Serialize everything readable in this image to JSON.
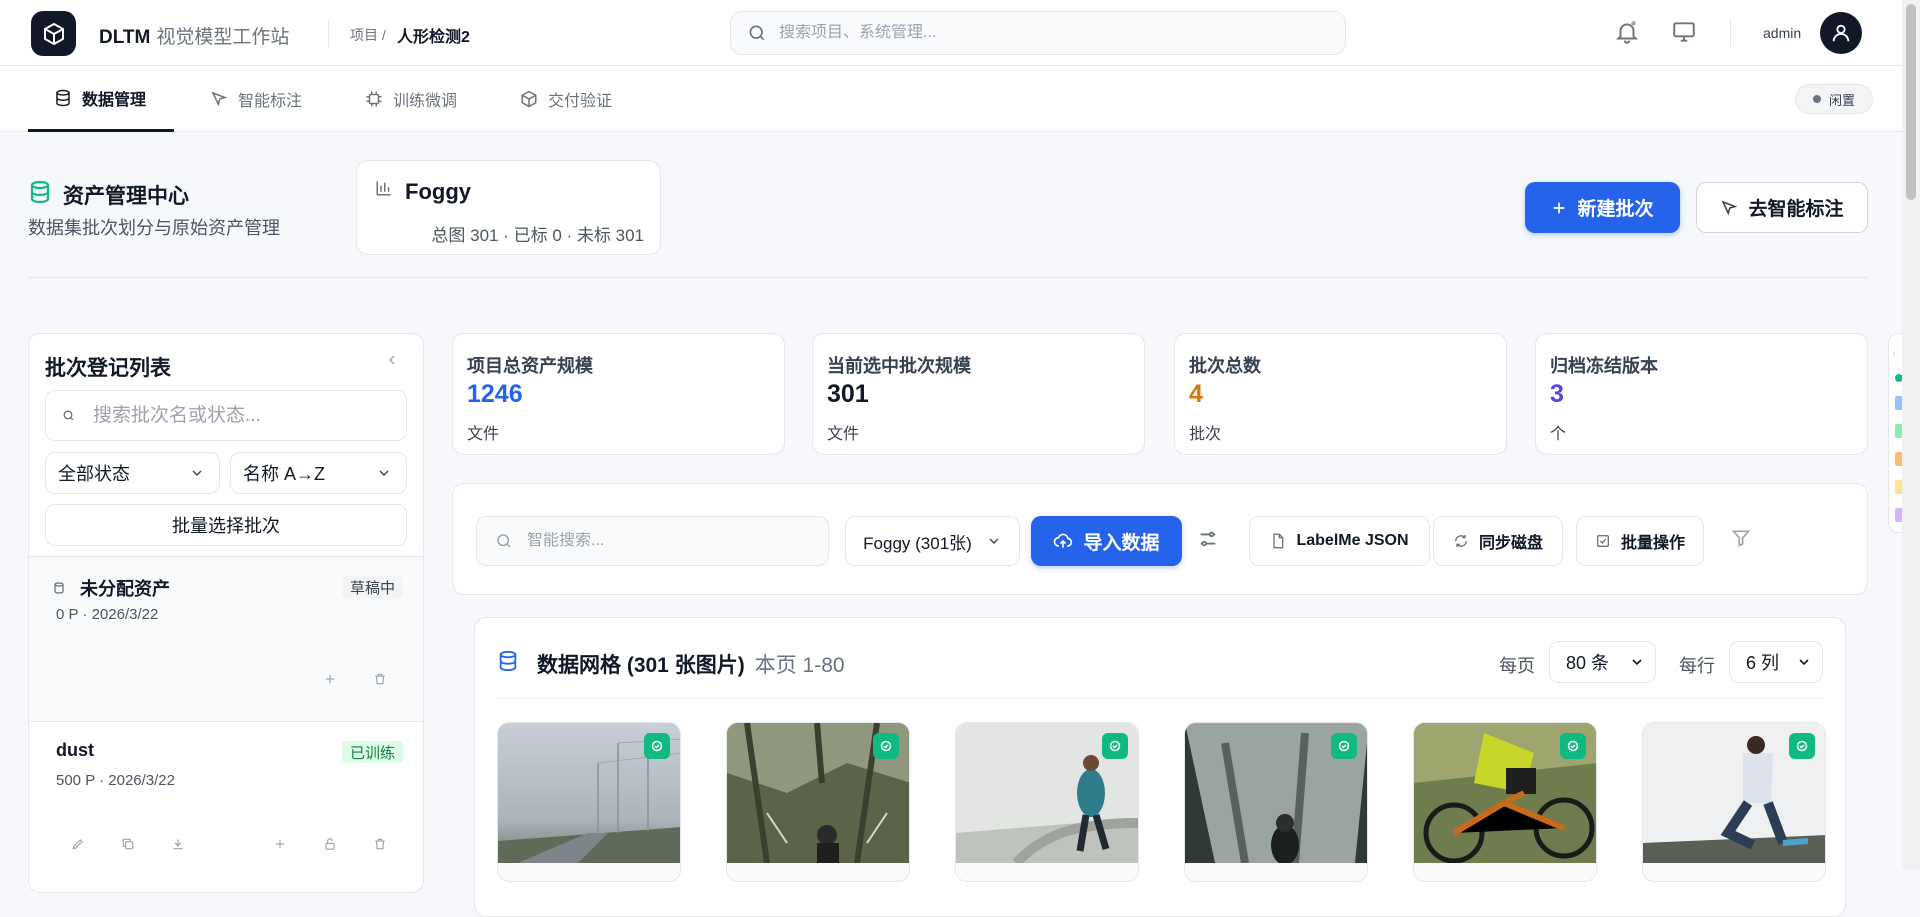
{
  "header": {
    "app_name": "DLTM",
    "app_subtitle": "视觉模型工作站",
    "crumb_prefix": "项目 /",
    "project_name": "人形检测2",
    "search_placeholder": "搜索项目、系统管理...",
    "user": "admin"
  },
  "tabs": [
    {
      "label": "数据管理",
      "icon": "database-icon",
      "active": true
    },
    {
      "label": "智能标注",
      "icon": "cursor-icon",
      "active": false
    },
    {
      "label": "训练微调",
      "icon": "cpu-icon",
      "active": false
    },
    {
      "label": "交付验证",
      "icon": "box-icon",
      "active": false
    }
  ],
  "status_pill": "闲置",
  "asset_center": {
    "title": "资产管理中心",
    "subtitle": "数据集批次划分与原始资产管理",
    "batch_name": "Foggy",
    "batch_stats": "总图 301 · 已标 0 · 未标 301",
    "new_batch_label": "新建批次",
    "go_label_label": "去智能标注"
  },
  "left_panel": {
    "title": "批次登记列表",
    "search_placeholder": "搜索批次名或状态...",
    "status_filter": "全部状态",
    "sort": "名称 A→Z",
    "bulk_select": "批量选择批次",
    "batches": [
      {
        "name": "未分配资产",
        "meta": "0 P · 2026/3/22",
        "badge": "草稿中",
        "badge_type": "draft"
      },
      {
        "name": "dust",
        "meta": "500 P · 2026/3/22",
        "badge": "已训练",
        "badge_type": "trained"
      }
    ]
  },
  "stats": [
    {
      "label": "项目总资产规模",
      "value": "1246",
      "unit": "文件",
      "color": "#2563eb"
    },
    {
      "label": "当前选中批次规模",
      "value": "301",
      "unit": "文件",
      "color": "#111827"
    },
    {
      "label": "批次总数",
      "value": "4",
      "unit": "批次",
      "color": "#d97706"
    },
    {
      "label": "归档冻结版本",
      "value": "3",
      "unit": "个",
      "color": "#4f46e5"
    }
  ],
  "toolbar": {
    "search_placeholder": "智能搜索...",
    "batch_select": "Foggy (301张)",
    "import_label": "导入数据",
    "labelme_label": "LabelMe JSON",
    "sync_label": "同步磁盘",
    "bulk_label": "批量操作"
  },
  "grid": {
    "title": "数据网格 (301 张图片)",
    "range": "本页 1-80",
    "per_page_label": "每页",
    "per_page": "80 条",
    "per_row_label": "每行",
    "per_row": "6 列",
    "thumbnails": [
      {
        "scene": "foggy-road"
      },
      {
        "scene": "forest-hiker"
      },
      {
        "scene": "fog-runner"
      },
      {
        "scene": "misty-forest"
      },
      {
        "scene": "mountain-biker"
      },
      {
        "scene": "stretching-woman"
      }
    ]
  }
}
